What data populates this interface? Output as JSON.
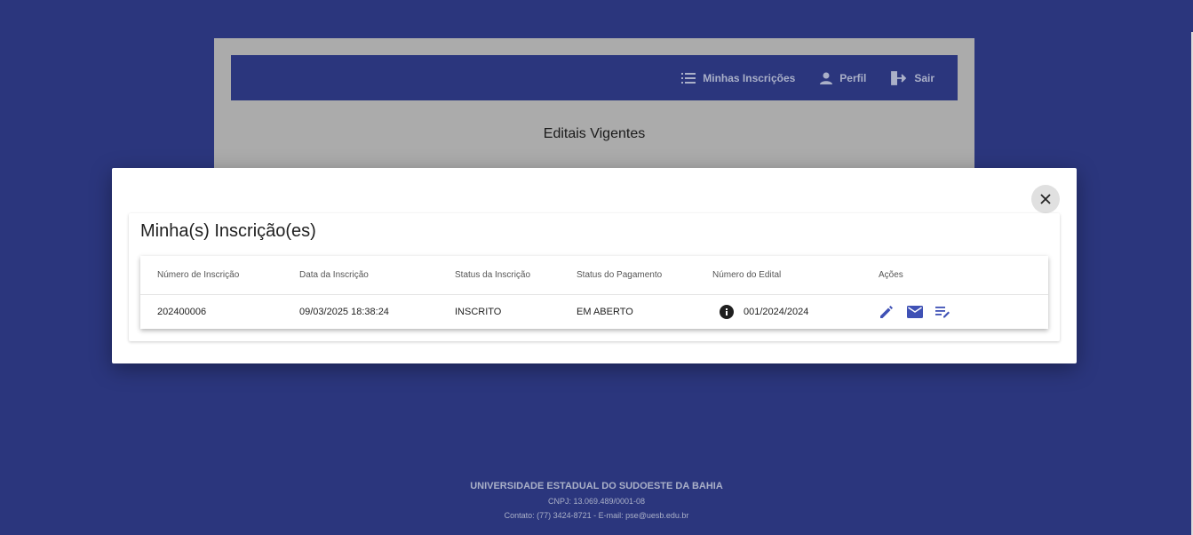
{
  "nav": {
    "items": [
      {
        "label": "Minhas Inscrições",
        "icon": "list-icon"
      },
      {
        "label": "Perfil",
        "icon": "person-icon"
      },
      {
        "label": "Sair",
        "icon": "logout-icon"
      }
    ]
  },
  "page": {
    "title": "Editais Vigentes"
  },
  "modal": {
    "title": "Minha(s) Inscrição(es)",
    "close_icon": "close-icon",
    "table": {
      "headers": [
        "Número de Inscrição",
        "Data da Inscrição",
        "Status da Inscrição",
        "Status do Pagamento",
        "Número do Edital",
        "Ações"
      ],
      "rows": [
        {
          "numero": "202400006",
          "data": "09/03/2025 18:38:24",
          "status_inscricao": "INSCRITO",
          "status_pagamento": "EM ABERTO",
          "edital": "001/2024/2024",
          "actions": [
            "edit-icon",
            "mail-icon",
            "edit-note-icon"
          ]
        }
      ]
    }
  },
  "footer": {
    "org": "UNIVERSIDADE ESTADUAL DO SUDOESTE DA BAHIA",
    "cnpj": "CNPJ: 13.069.489/0001-08",
    "contact": "Contato: (77) 3424-8721 - E-mail: pse@uesb.edu.br"
  },
  "colors": {
    "primary": "#2b367d",
    "accent_icon": "#3f51b5",
    "overlay_card": "#ababab"
  }
}
